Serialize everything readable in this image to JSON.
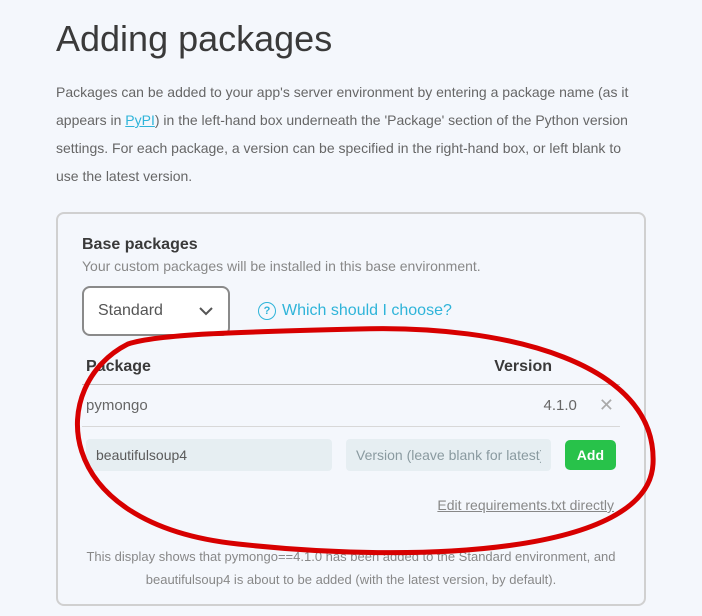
{
  "heading": "Adding packages",
  "intro_before": "Packages can be added to your app's server environment by entering a package name (as it appears in ",
  "intro_link": "PyPI",
  "intro_after": ") in the left-hand box underneath the 'Package' section of the Python version settings. For each package, a version can be specified in the right-hand box, or left blank to use the latest version.",
  "base": {
    "title": "Base packages",
    "desc": "Your custom packages will be installed in this base environment.",
    "selected": "Standard",
    "help": "Which should I choose?"
  },
  "headers": {
    "pkg": "Package",
    "ver": "Version"
  },
  "row": {
    "name": "pymongo",
    "version": "4.1.0"
  },
  "input": {
    "name_value": "beautifulsoup4",
    "ver_placeholder": "Version (leave blank for latest)",
    "add_label": "Add"
  },
  "edit_link": "Edit requirements.txt directly",
  "caption_1": "This display shows that pymongo==4.1.0 has been added to the Standard environment, and",
  "caption_2": "beautifulsoup4 is about to be added (with the latest version, by default)."
}
